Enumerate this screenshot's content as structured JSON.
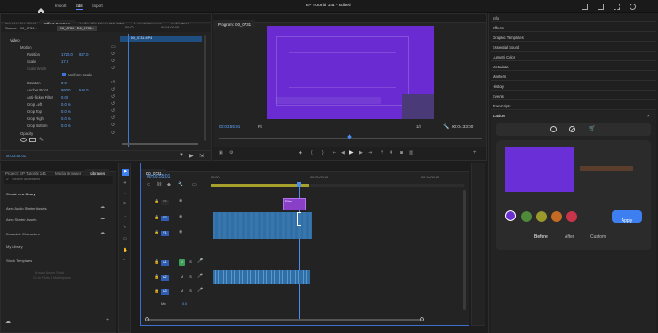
{
  "topbar": {
    "home_icon": "home-icon",
    "nav": [
      "Import",
      "Edit",
      "Export"
    ],
    "active_nav": "Edit",
    "title": "EP Tutorial 141 - Edited"
  },
  "source_panel": {
    "tabs": [
      "Source: (no clips)",
      "Effect Controls",
      "Audio Clip Mixer: D0_0731",
      "Lumetri Scopes",
      "Audio Trac"
    ],
    "active_tab": "Effect Controls",
    "master_label": "Source · D0_0731...",
    "clip_label": "D0_0731 · D0_0731...",
    "ruler_start": "00:00",
    "ruler_mid": "00:04:00:00",
    "clip_name": "D0_0731.MP4",
    "section_video": "Video",
    "rows": [
      {
        "label": "Motion",
        "type": "group"
      },
      {
        "label": "Position",
        "v1": "1720.0",
        "v2": "927.0"
      },
      {
        "label": "Scale",
        "v1": "17.0"
      },
      {
        "label": "Scale Width",
        "v1": ""
      },
      {
        "label": "Uniform Scale",
        "type": "checkbox"
      },
      {
        "label": "Rotation",
        "v1": "0.0"
      },
      {
        "label": "Anchor Point",
        "v1": "960.0",
        "v2": "540.0"
      },
      {
        "label": "Anti-flicker Filter",
        "v1": "0.00"
      },
      {
        "label": "Crop Left",
        "v1": "0.0 %"
      },
      {
        "label": "Crop Top",
        "v1": "0.0 %"
      },
      {
        "label": "Crop Right",
        "v1": "0.0 %"
      },
      {
        "label": "Crop Bottom",
        "v1": "0.0 %"
      },
      {
        "label": "Opacity",
        "type": "group"
      }
    ],
    "timecode": "00:03:55:01"
  },
  "program_panel": {
    "title": "Program: D0_0731",
    "timecode_left": "00:03:55:01",
    "zoom": "Fit",
    "quality": "1/4",
    "timecode_right": "00:04:33:00"
  },
  "right_panel": {
    "items": [
      "Info",
      "Effects",
      "Graphic Templates",
      "Essential Sound",
      "Lumetri Color",
      "Metadata",
      "Markers",
      "History",
      "Events",
      "Transcripts"
    ],
    "ladder": {
      "title": "Ladder",
      "apply_label": "Apply",
      "compare_tabs": [
        "Before",
        "After",
        "Custom"
      ],
      "active_compare": "Before",
      "swatches": [
        "#6a2fd0",
        "#4f8a3a",
        "#9a9a2c",
        "#c56a24",
        "#c8344a"
      ],
      "preview_colors": {
        "left": "#6b2fd8",
        "right_top": "#2b2b2b",
        "right_bar": "#5a3d2b"
      }
    }
  },
  "libraries_panel": {
    "tabs": [
      "Project: EP Tutorial 141",
      "Media Browser",
      "Libraries"
    ],
    "active_tab": "Libraries",
    "search_placeholder": "Search all libraries",
    "create_label": "Create new library",
    "items": [
      "Aero Audio Starter Assets",
      "Aero Starter Assets",
      "Drawable Characters",
      "My Library",
      "Stock Templates"
    ],
    "footer_1": "Browse Adobe Stock",
    "footer_2": "Go to Fonts & Marketplace"
  },
  "timeline": {
    "tab": "D0_0731",
    "timecode": "00:03:55:01",
    "ruler": [
      "00:00",
      "00:05:00:00",
      "00:10:00:00"
    ],
    "video_tracks": [
      "V3",
      "V2",
      "V1"
    ],
    "audio_tracks": [
      "A1",
      "A2",
      "A3"
    ],
    "mix_label": "Mix",
    "mix_value": "0.0",
    "fx_clip_label": "Film..."
  }
}
